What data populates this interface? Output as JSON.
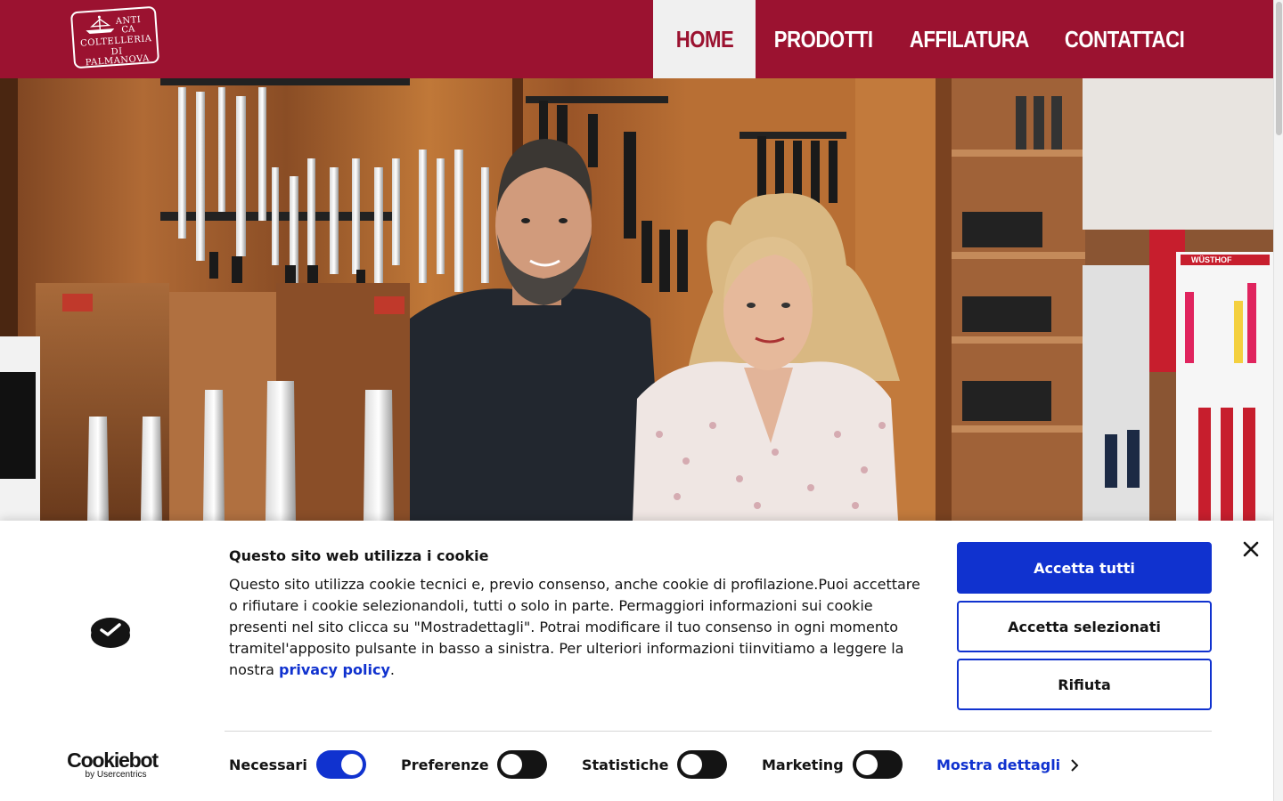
{
  "header": {
    "logo": {
      "line1": "ANTI",
      "line2": "CA",
      "line3": "COLTELLERIA",
      "line4": "DI PALMANOVA"
    },
    "nav": [
      {
        "label": "HOME",
        "active": true
      },
      {
        "label": "PRODOTTI",
        "active": false
      },
      {
        "label": "AFFILATURA",
        "active": false
      },
      {
        "label": "CONTATTACI",
        "active": false
      }
    ]
  },
  "hero": {
    "brand_sign": "WÜSTHOF"
  },
  "cookie": {
    "title": "Questo sito web utilizza i cookie",
    "text": "Questo sito utilizza cookie tecnici e, previo consenso, anche cookie di profilazione.Puoi accettare o rifiutare i cookie selezionandoli, tutti o solo in parte. Permaggiori informazioni sui cookie presenti nel sito clicca su \"Mostradettagli\". Potrai modificare il tuo consenso in ogni momento tramitel'apposito pulsante in basso a sinistra. Per ulteriori informazioni tiinvitiamo a leggere la nostra ",
    "link": "privacy policy",
    "text_end": ".",
    "buttons": {
      "accept_all": "Accetta tutti",
      "accept_selected": "Accetta selezionati",
      "reject": "Rifiuta"
    },
    "toggles": [
      {
        "label": "Necessari",
        "on": true
      },
      {
        "label": "Preferenze",
        "on": false
      },
      {
        "label": "Statistiche",
        "on": false
      },
      {
        "label": "Marketing",
        "on": false
      }
    ],
    "details": "Mostra dettagli",
    "brand": {
      "name": "Cookiebot",
      "sub": "by Usercentrics"
    }
  },
  "colors": {
    "brand_red": "#9b1230",
    "accent_blue": "#1032cf",
    "text": "#141414"
  }
}
